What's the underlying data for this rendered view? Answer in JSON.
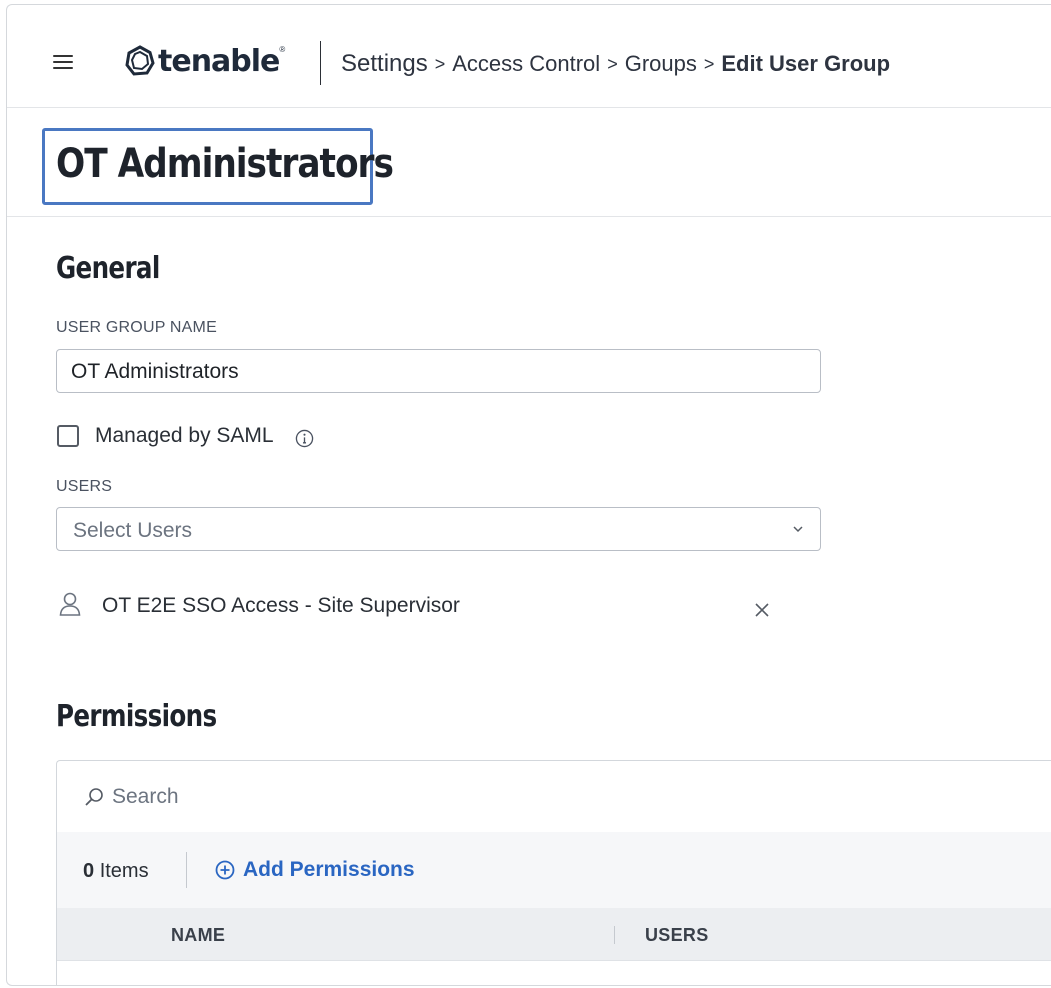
{
  "header": {
    "brand": "tenable",
    "breadcrumb": {
      "items": [
        "Settings",
        "Access Control",
        "Groups"
      ],
      "current": "Edit User Group",
      "separator": ">"
    }
  },
  "page": {
    "title": "OT Administrators"
  },
  "general": {
    "heading": "General",
    "group_name_label": "USER GROUP NAME",
    "group_name_value": "OT Administrators",
    "managed_by_saml_label": "Managed by SAML",
    "managed_by_saml_checked": false,
    "users_label": "USERS",
    "users_placeholder": "Select Users",
    "selected_users": [
      "OT E2E SSO Access - Site Supervisor"
    ]
  },
  "permissions": {
    "heading": "Permissions",
    "search_placeholder": "Search",
    "item_count": "0",
    "items_label": "Items",
    "add_label": "Add Permissions",
    "columns": [
      "NAME",
      "USERS"
    ]
  },
  "colors": {
    "accent": "#2a66c2",
    "highlight_border": "#4a78c2"
  }
}
